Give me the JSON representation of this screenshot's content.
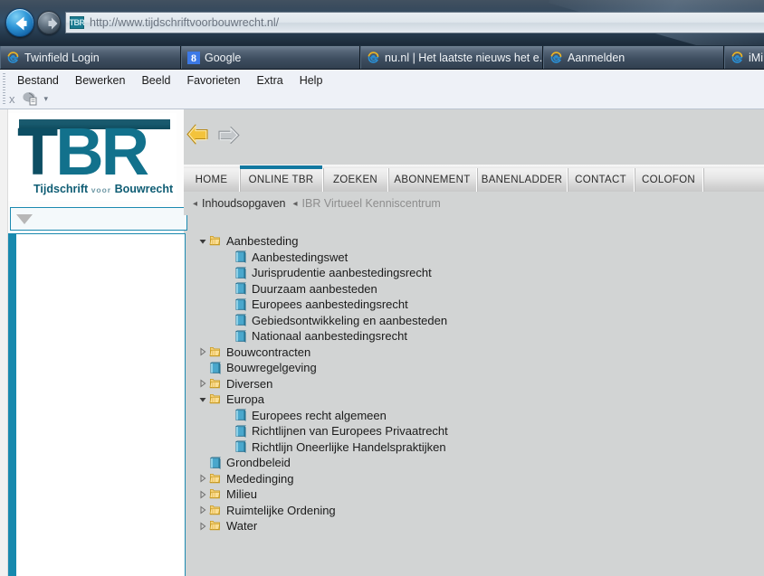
{
  "browser": {
    "back_icon": "back-arrow-icon",
    "forward_icon": "forward-arrow-icon",
    "address": {
      "favicon_text": "TBR",
      "url": "http://www.tijdschriftvoorbouwrecht.nl/"
    },
    "tabs": [
      {
        "label": "Twinfield Login",
        "icon": "internet-explorer-icon"
      },
      {
        "label": "Google",
        "icon": "google-icon"
      },
      {
        "label": "nu.nl | Het laatste nieuws het e...",
        "icon": "internet-explorer-icon"
      },
      {
        "label": "Aanmelden",
        "icon": "internet-explorer-icon"
      },
      {
        "label": "iMi",
        "icon": "internet-explorer-icon"
      }
    ],
    "menu": [
      "Bestand",
      "Bewerken",
      "Beeld",
      "Favorieten",
      "Extra",
      "Help"
    ],
    "command_bar": {
      "close_label": "x",
      "dropdown_caret": "▾"
    }
  },
  "site": {
    "logo": {
      "letters": "TBR",
      "tagline_1": "Tijdschrift",
      "tagline_2": "voor",
      "tagline_3": "Bouwrecht"
    },
    "sidebar": {
      "select_value": "",
      "select_caret": "dropdown-caret-icon"
    },
    "content_nav": {
      "back_icon": "page-back-arrow-icon",
      "forward_icon": "page-forward-arrow-icon"
    },
    "tabs": [
      {
        "label": "HOME",
        "active": false
      },
      {
        "label": "ONLINE TBR",
        "active": true
      },
      {
        "label": "ZOEKEN",
        "active": false
      },
      {
        "label": "ABONNEMENT",
        "active": false
      },
      {
        "label": "BANENLADDER",
        "active": false
      },
      {
        "label": "CONTACT",
        "active": false
      },
      {
        "label": "COLOFON",
        "active": false
      }
    ],
    "breadcrumb": {
      "arrow": "◂",
      "item_1": "Inhoudsopgaven",
      "item_2": "IBR Virtueel Kenniscentrum"
    },
    "colors": {
      "brand_teal": "#1278a0",
      "logo_teal": "#12718c",
      "logo_dark": "#0d4e63",
      "folder_yellow": "#f5c544",
      "book_blue": "#3f9ec4"
    }
  },
  "tree": [
    {
      "label": "Aanbesteding",
      "type": "folder",
      "state": "expanded",
      "level": 0
    },
    {
      "label": "Aanbestedingswet",
      "type": "book",
      "state": "leaf",
      "level": 1
    },
    {
      "label": "Jurisprudentie aanbestedingsrecht",
      "type": "book",
      "state": "leaf",
      "level": 1
    },
    {
      "label": "Duurzaam aanbesteden",
      "type": "book",
      "state": "leaf",
      "level": 1
    },
    {
      "label": "Europees aanbestedingsrecht",
      "type": "book",
      "state": "leaf",
      "level": 1
    },
    {
      "label": "Gebiedsontwikkeling en aanbesteden",
      "type": "book",
      "state": "leaf",
      "level": 1
    },
    {
      "label": "Nationaal aanbestedingsrecht",
      "type": "book",
      "state": "leaf",
      "level": 1
    },
    {
      "label": "Bouwcontracten",
      "type": "folder",
      "state": "collapsed",
      "level": 0
    },
    {
      "label": "Bouwregelgeving",
      "type": "book",
      "state": "leaf",
      "level": 0
    },
    {
      "label": "Diversen",
      "type": "folder",
      "state": "collapsed",
      "level": 0
    },
    {
      "label": "Europa",
      "type": "folder",
      "state": "expanded",
      "level": 0
    },
    {
      "label": "Europees recht algemeen",
      "type": "book",
      "state": "leaf",
      "level": 1
    },
    {
      "label": "Richtlijnen van Europees Privaatrecht",
      "type": "book",
      "state": "leaf",
      "level": 1
    },
    {
      "label": "Richtlijn Oneerlijke Handelspraktijken",
      "type": "book",
      "state": "leaf",
      "level": 1
    },
    {
      "label": "Grondbeleid",
      "type": "book",
      "state": "leaf",
      "level": 0
    },
    {
      "label": "Mededinging",
      "type": "folder",
      "state": "collapsed",
      "level": 0
    },
    {
      "label": "Milieu",
      "type": "folder",
      "state": "collapsed",
      "level": 0
    },
    {
      "label": "Ruimtelijke Ordening",
      "type": "folder",
      "state": "collapsed",
      "level": 0
    },
    {
      "label": "Water",
      "type": "folder",
      "state": "collapsed",
      "level": 0
    }
  ]
}
